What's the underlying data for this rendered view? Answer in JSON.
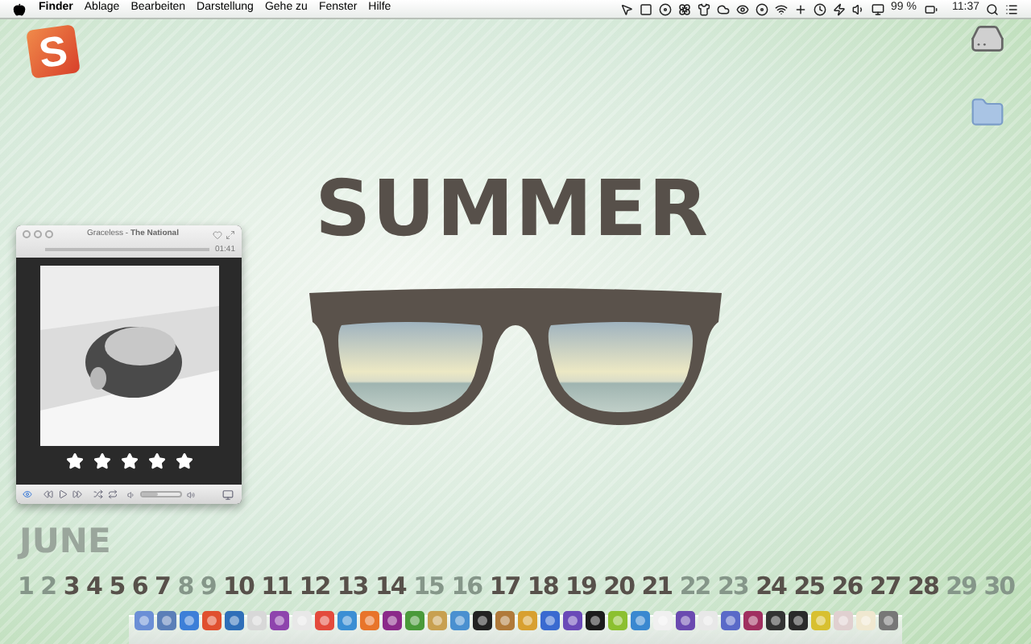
{
  "menu_bar": {
    "app_name": "Finder",
    "menus": [
      "Ablage",
      "Bearbeiten",
      "Darstellung",
      "Gehe zu",
      "Fenster",
      "Hilfe"
    ],
    "battery_percent": "99 %",
    "clock": "11:37"
  },
  "desktop_logo": {
    "glyph": "S"
  },
  "wallpaper": {
    "headline": "SUMMER",
    "month": "JUNE",
    "days": [
      {
        "day": "1",
        "weekend": true
      },
      {
        "day": "2",
        "weekend": true
      },
      {
        "day": "3",
        "weekend": false
      },
      {
        "day": "4",
        "weekend": false
      },
      {
        "day": "5",
        "weekend": false
      },
      {
        "day": "6",
        "weekend": false
      },
      {
        "day": "7",
        "weekend": false
      },
      {
        "day": "8",
        "weekend": true
      },
      {
        "day": "9",
        "weekend": true
      },
      {
        "day": "10",
        "weekend": false
      },
      {
        "day": "11",
        "weekend": false
      },
      {
        "day": "12",
        "weekend": false
      },
      {
        "day": "13",
        "weekend": false
      },
      {
        "day": "14",
        "weekend": false
      },
      {
        "day": "15",
        "weekend": true
      },
      {
        "day": "16",
        "weekend": true
      },
      {
        "day": "17",
        "weekend": false
      },
      {
        "day": "18",
        "weekend": false
      },
      {
        "day": "19",
        "weekend": false
      },
      {
        "day": "20",
        "weekend": false
      },
      {
        "day": "21",
        "weekend": false
      },
      {
        "day": "22",
        "weekend": true
      },
      {
        "day": "23",
        "weekend": true
      },
      {
        "day": "24",
        "weekend": false
      },
      {
        "day": "25",
        "weekend": false
      },
      {
        "day": "26",
        "weekend": false
      },
      {
        "day": "27",
        "weekend": false
      },
      {
        "day": "28",
        "weekend": false
      },
      {
        "day": "29",
        "weekend": true
      },
      {
        "day": "30",
        "weekend": true
      }
    ]
  },
  "player": {
    "title": "Graceless - **The National**",
    "time": "01:41",
    "stars": 5,
    "volume": {
      "level": 0.4
    }
  }
}
